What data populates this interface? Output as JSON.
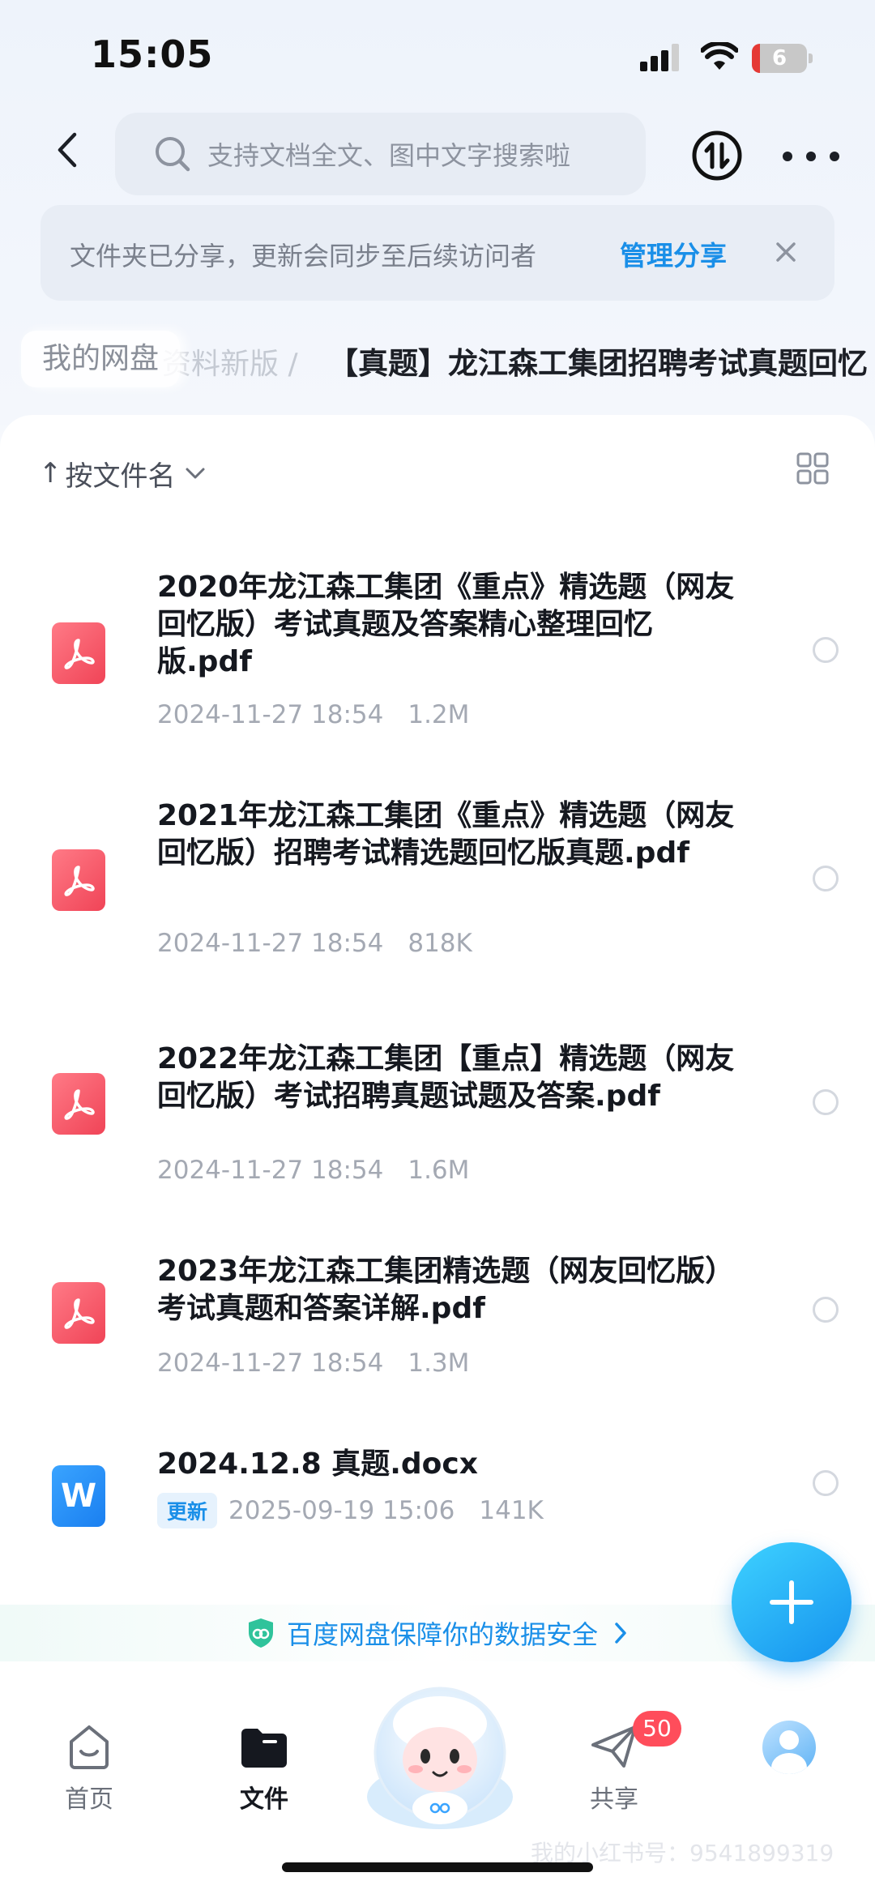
{
  "status_bar": {
    "time": "15:05",
    "battery_level": "6",
    "battery_percent": 6
  },
  "search": {
    "placeholder": "支持文档全文、图中文字搜索啦"
  },
  "share_notice": {
    "text": "文件夹已分享，更新会同步至后续访问者",
    "manage_label": "管理分享"
  },
  "breadcrumb": {
    "root": "我的网盘",
    "middle": "资料新版",
    "separator": "/",
    "current": "【真题】龙江森工集团招聘考试真题回忆"
  },
  "sort": {
    "label": "按文件名",
    "arrow": "↑"
  },
  "files": [
    {
      "name": "2020年龙江森工集团《重点》精选题（网友回忆版）考试真题及答案精心整理回忆版.pdf",
      "date": "2024-11-27 18:54",
      "size": "1.2M",
      "type": "pdf"
    },
    {
      "name": "2021年龙江森工集团《重点》精选题（网友回忆版）招聘考试精选题回忆版真题.pdf",
      "date": "2024-11-27 18:54",
      "size": "818K",
      "type": "pdf"
    },
    {
      "name": "2022年龙江森工集团【重点】精选题（网友回忆版）考试招聘真题试题及答案.pdf",
      "date": "2024-11-27 18:54",
      "size": "1.6M",
      "type": "pdf"
    },
    {
      "name": "2023年龙江森工集团精选题（网友回忆版）考试真题和答案详解.pdf",
      "date": "2024-11-27 18:54",
      "size": "1.3M",
      "type": "pdf"
    },
    {
      "name": "2024.12.8 真题.docx",
      "badge": "更新",
      "date": "2025-09-19 15:06",
      "size": "141K",
      "type": "docx",
      "icon_letter": "W"
    }
  ],
  "safety_notice": "百度网盘保障你的数据安全",
  "tabs": [
    {
      "label": "首页"
    },
    {
      "label": "文件"
    },
    {
      "label": "共享",
      "badge": "50"
    }
  ],
  "watermark": "我的小红书号：9541899319",
  "colors": {
    "accent": "#1a8fe8",
    "pdf": "#f04457",
    "badge": "#ff4d5b"
  }
}
